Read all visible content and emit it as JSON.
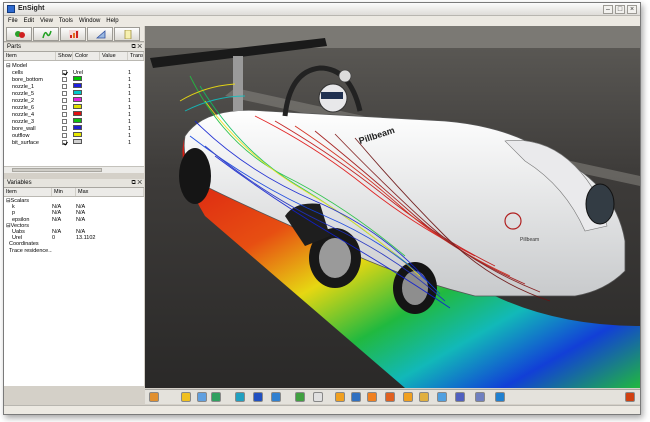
{
  "window": {
    "title": "EnSight"
  },
  "menu": [
    "File",
    "Edit",
    "View",
    "Tools",
    "Window",
    "Help"
  ],
  "toolbar": {
    "buttons": [
      {
        "icon": "parts-icon"
      },
      {
        "icon": "variables-icon"
      },
      {
        "icon": "plot-icon"
      },
      {
        "icon": "annotate-icon"
      },
      {
        "icon": "notes-icon"
      }
    ]
  },
  "parts": {
    "title": "Parts",
    "columns": [
      "Item",
      "Show",
      "Color",
      "Value",
      "Trans"
    ],
    "group": "Model",
    "rows": [
      {
        "name": "cells",
        "show": true,
        "color": "",
        "color_text": "Urel",
        "trans": "1"
      },
      {
        "name": "bore_bottom",
        "show": false,
        "color": "#00c800",
        "trans": "1"
      },
      {
        "name": "nozzle_1",
        "show": false,
        "color": "#1e1ee0",
        "trans": "1"
      },
      {
        "name": "nozzle_5",
        "show": false,
        "color": "#00c8c8",
        "trans": "1"
      },
      {
        "name": "nozzle_2",
        "show": false,
        "color": "#e020e0",
        "trans": "1"
      },
      {
        "name": "nozzle_6",
        "show": false,
        "color": "#e0e000",
        "trans": "1"
      },
      {
        "name": "nozzle_4",
        "show": false,
        "color": "#e01010",
        "trans": "1"
      },
      {
        "name": "nozzle_3",
        "show": false,
        "color": "#10c010",
        "trans": "1"
      },
      {
        "name": "bore_wall",
        "show": false,
        "color": "#2020d0",
        "trans": "1"
      },
      {
        "name": "outflow",
        "show": false,
        "color": "#e8e800",
        "trans": "1"
      },
      {
        "name": "bit_surface",
        "show": true,
        "color": "#d0d0d0",
        "trans": "1"
      }
    ]
  },
  "variables": {
    "title": "Variables",
    "columns": [
      "Item",
      "Min",
      "Max"
    ],
    "rows": [
      {
        "name": "Scalars",
        "min": "",
        "max": "",
        "indent": 0,
        "tree": "-"
      },
      {
        "name": "k",
        "min": "N/A",
        "max": "N/A",
        "indent": 2,
        "tree": ""
      },
      {
        "name": "p",
        "min": "N/A",
        "max": "N/A",
        "indent": 2,
        "tree": ""
      },
      {
        "name": "epsilon",
        "min": "N/A",
        "max": "N/A",
        "indent": 2,
        "tree": ""
      },
      {
        "name": "Vectors",
        "min": "",
        "max": "",
        "indent": 0,
        "tree": "-"
      },
      {
        "name": "Uabs",
        "min": "N/A",
        "max": "N/A",
        "indent": 2,
        "tree": ""
      },
      {
        "name": "Urel",
        "min": "0",
        "max": "13.1102",
        "indent": 2,
        "tree": ""
      },
      {
        "name": "Coordinates",
        "min": "",
        "max": "",
        "indent": 1,
        "tree": ""
      },
      {
        "name": "Trace residence....",
        "min": "",
        "max": "",
        "indent": 1,
        "tree": ""
      }
    ]
  },
  "viewport": {
    "banner_text": "Pillbeam",
    "nose_text": "Pillbeam"
  },
  "colors": {
    "chrome": "#d4d0c8",
    "flow_red": "#e01010",
    "flow_yellow": "#f0e010",
    "flow_green": "#20c040",
    "flow_blue": "#1020d0"
  }
}
